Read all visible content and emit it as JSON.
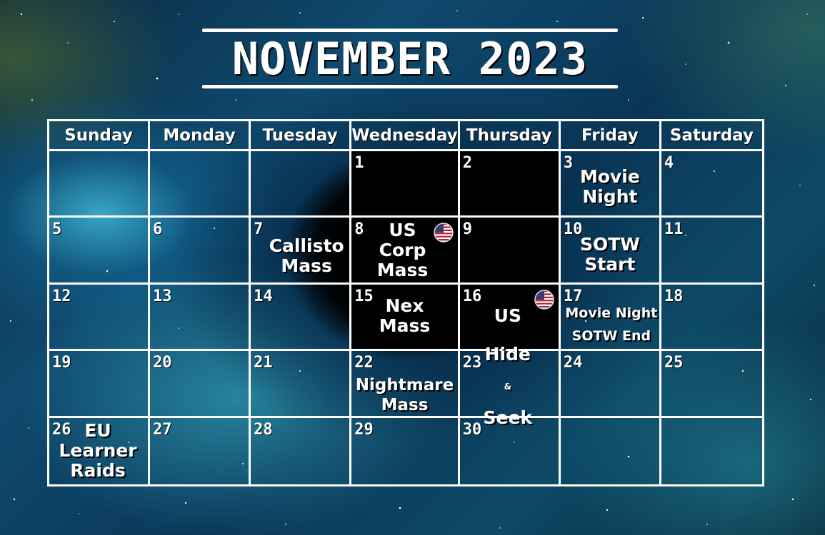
{
  "title": "NOVEMBER 2023",
  "weekdays": [
    "Sunday",
    "Monday",
    "Tuesday",
    "Wednesday",
    "Thursday",
    "Friday",
    "Saturday"
  ],
  "days": {
    "d1": "1",
    "d2": "2",
    "d3": "3",
    "d4": "4",
    "d5": "5",
    "d6": "6",
    "d7": "7",
    "d8": "8",
    "d9": "9",
    "d10": "10",
    "d11": "11",
    "d12": "12",
    "d13": "13",
    "d14": "14",
    "d15": "15",
    "d16": "16",
    "d17": "17",
    "d18": "18",
    "d19": "19",
    "d20": "20",
    "d21": "21",
    "d22": "22",
    "d23": "23",
    "d24": "24",
    "d25": "25",
    "d26": "26",
    "d27": "27",
    "d28": "28",
    "d29": "29",
    "d30": "30"
  },
  "events": {
    "nov3": "Movie\nNight",
    "nov7": "Callisto\nMass",
    "nov8": "US\nCorp\nMass",
    "nov10": "SOTW\nStart",
    "nov15": "Nex\nMass",
    "nov16_line1": "US",
    "nov16_line2": "Hide",
    "nov16_amp": "&",
    "nov16_line3": "Seek",
    "nov17": "Movie Night\nSOTW End",
    "nov22": "Nightmare\nMass",
    "nov26": "EU\nLearner\nRaids"
  },
  "icons": {
    "flag": "us-flag-icon"
  },
  "colors": {
    "grid": "#ffffff",
    "text": "#ffffff",
    "dark_cell": "#000000",
    "flag_red": "#b22234",
    "flag_blue": "#3c3b6e"
  }
}
